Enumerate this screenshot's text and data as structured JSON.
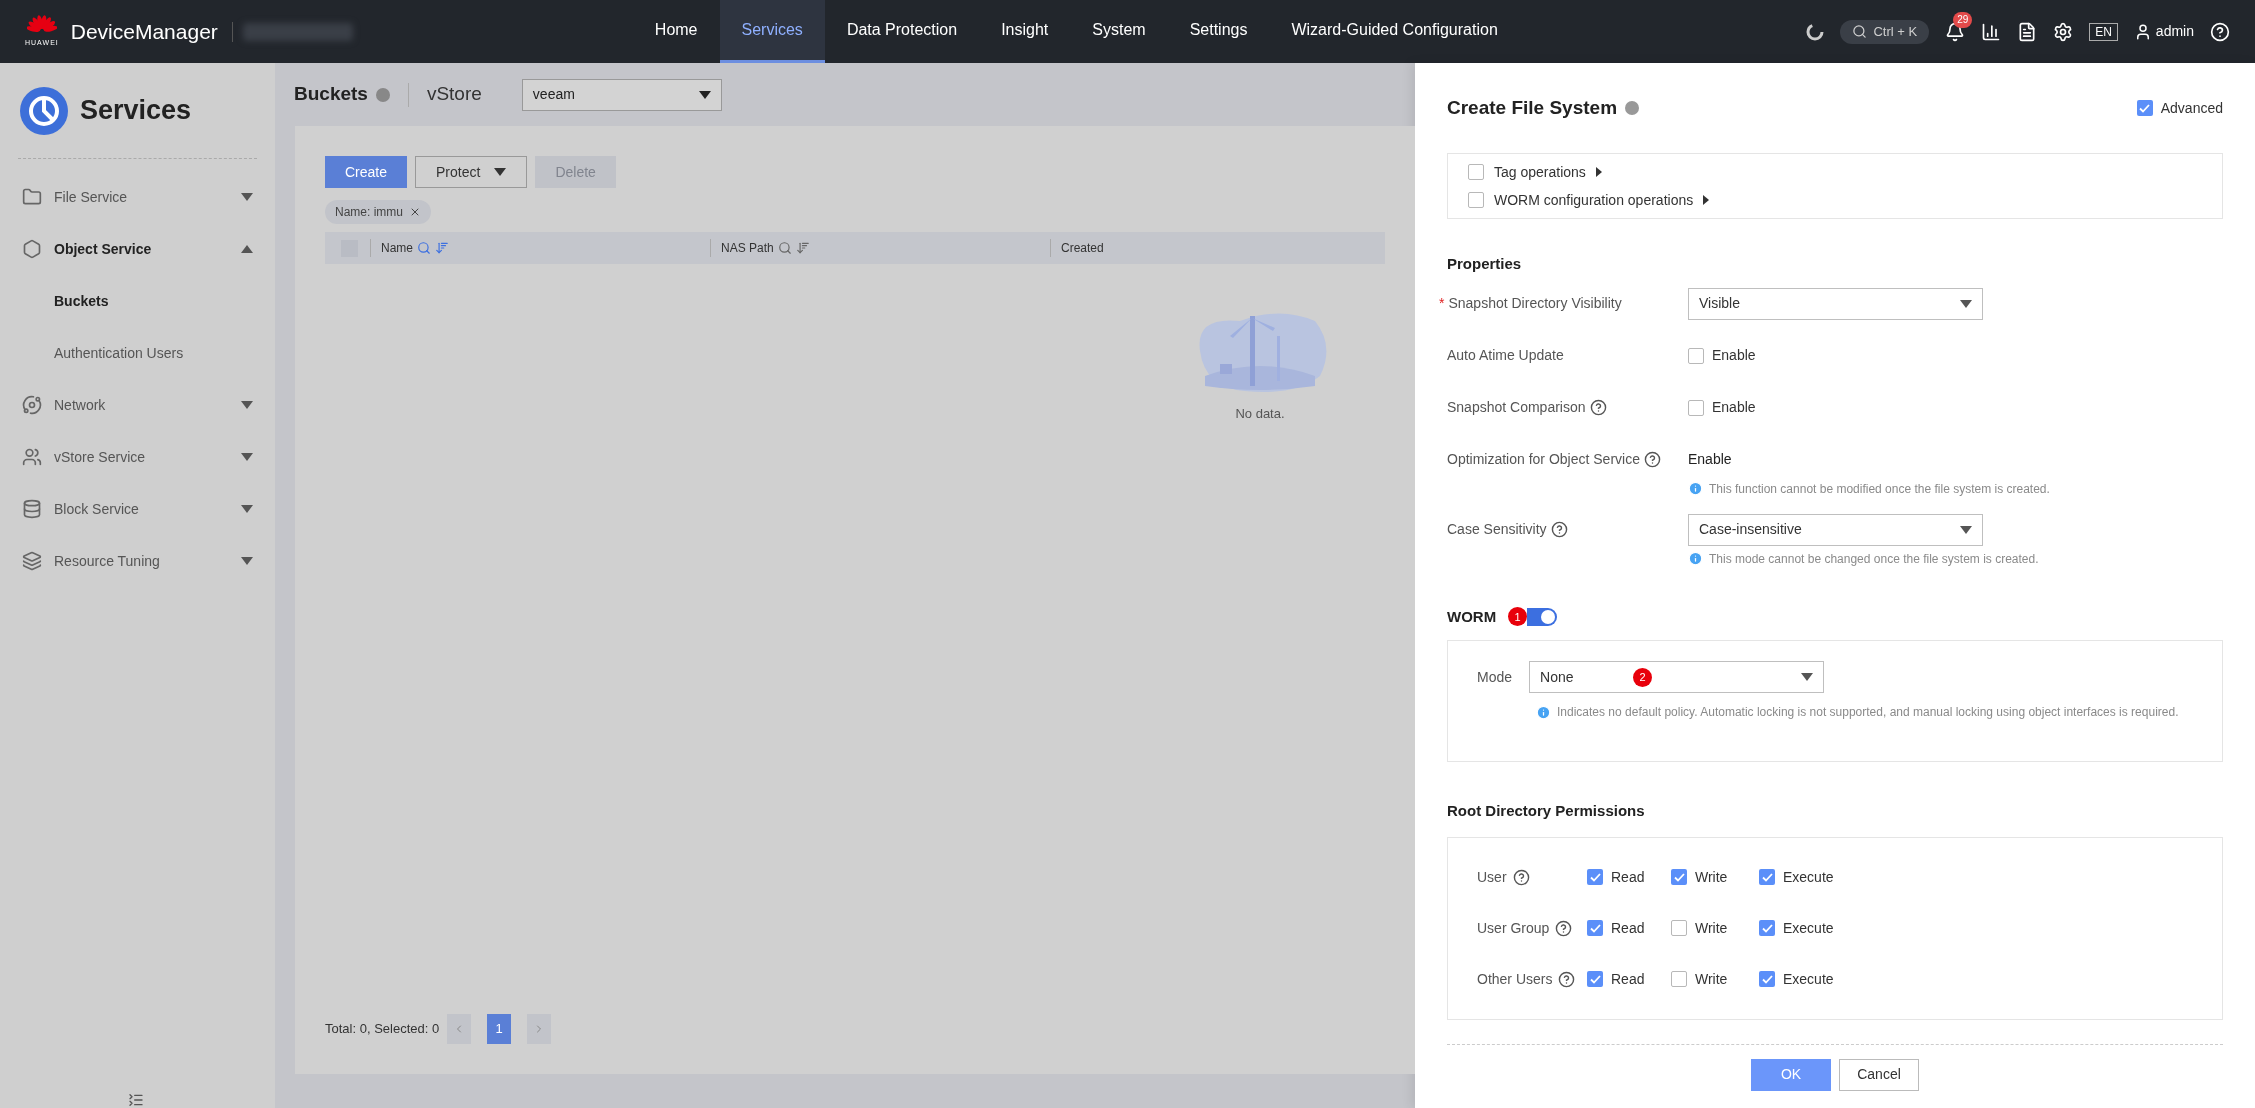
{
  "topbar": {
    "brand_small": "HUAWEI",
    "app_name": "DeviceManager",
    "nav": [
      {
        "label": "Home",
        "selected": false
      },
      {
        "label": "Services",
        "selected": true
      },
      {
        "label": "Data Protection",
        "selected": false
      },
      {
        "label": "Insight",
        "selected": false
      },
      {
        "label": "System",
        "selected": false
      },
      {
        "label": "Settings",
        "selected": false
      },
      {
        "label": "Wizard-Guided Configuration",
        "selected": false
      }
    ],
    "search_hint": "Ctrl + K",
    "alerts_badge": "29",
    "language": "EN",
    "user": "admin"
  },
  "sidebar": {
    "title": "Services",
    "items": [
      {
        "label": "File Service",
        "expanded": false
      },
      {
        "label": "Object Service",
        "expanded": true,
        "children": [
          {
            "label": "Buckets",
            "selected": true
          },
          {
            "label": "Authentication Users",
            "selected": false
          }
        ]
      },
      {
        "label": "Network",
        "expanded": false
      },
      {
        "label": "vStore Service",
        "expanded": false
      },
      {
        "label": "Block Service",
        "expanded": false
      },
      {
        "label": "Resource Tuning",
        "expanded": false
      }
    ]
  },
  "page": {
    "title": "Buckets",
    "vstore_label": "vStore",
    "vstore_value": "veeam",
    "buttons": [
      {
        "label": "Create",
        "kind": "primary"
      },
      {
        "label": "Protect",
        "kind": "menu"
      },
      {
        "label": "Delete",
        "kind": "disabled"
      }
    ],
    "filter_tag": "Name: immu",
    "table": {
      "all_selected": false,
      "columns": [
        {
          "label": "Name",
          "active": true
        },
        {
          "label": "NAS Path",
          "active": false
        },
        {
          "label": "Created",
          "active": false
        }
      ],
      "empty_text": "No data."
    },
    "pagination": {
      "summary": "Total: 0, Selected: 0",
      "pages": [
        {
          "label": "1",
          "selected": true
        }
      ]
    }
  },
  "panel": {
    "title": "Create File System",
    "advanced": {
      "label": "Advanced",
      "checked": true
    },
    "operations": [
      {
        "label": "Tag operations",
        "checked": false
      },
      {
        "label": "WORM configuration operations",
        "checked": false
      }
    ],
    "properties": {
      "heading": "Properties",
      "rows": [
        {
          "kind": "select",
          "label": "Snapshot Directory Visibility",
          "required_mark": "*",
          "help": false,
          "value": "Visible"
        },
        {
          "kind": "checkbox",
          "label": "Auto Atime Update",
          "help": false,
          "value": "Enable",
          "checked": false
        },
        {
          "kind": "checkbox",
          "label": "Snapshot Comparison",
          "help": true,
          "value": "Enable",
          "checked": false
        },
        {
          "kind": "text",
          "label": "Optimization for Object Service",
          "help": true,
          "value": "Enable",
          "hint": "This function cannot be modified once the file system is created."
        },
        {
          "kind": "select",
          "label": "Case Sensitivity",
          "help": true,
          "value": "Case-insensitive",
          "hint": "This mode cannot be changed once the file system is created."
        }
      ]
    },
    "worm": {
      "heading": "WORM",
      "on": true,
      "toggle_badge": "1",
      "mode_label": "Mode",
      "mode_value": "None",
      "mode_badge": "2",
      "hint": "Indicates no default policy. Automatic locking is not supported, and manual locking using object interfaces is required."
    },
    "permissions": {
      "heading": "Root Directory Permissions",
      "rows": [
        {
          "label": "User",
          "options": [
            {
              "label": "Read",
              "checked": true
            },
            {
              "label": "Write",
              "checked": true
            },
            {
              "label": "Execute",
              "checked": true
            }
          ]
        },
        {
          "label": "User Group",
          "options": [
            {
              "label": "Read",
              "checked": true
            },
            {
              "label": "Write",
              "checked": false
            },
            {
              "label": "Execute",
              "checked": true
            }
          ]
        },
        {
          "label": "Other Users",
          "options": [
            {
              "label": "Read",
              "checked": true
            },
            {
              "label": "Write",
              "checked": false
            },
            {
              "label": "Execute",
              "checked": true
            }
          ]
        }
      ]
    },
    "footer": [
      {
        "label": "OK",
        "kind": "primary"
      },
      {
        "label": "Cancel",
        "kind": "plain"
      }
    ]
  }
}
